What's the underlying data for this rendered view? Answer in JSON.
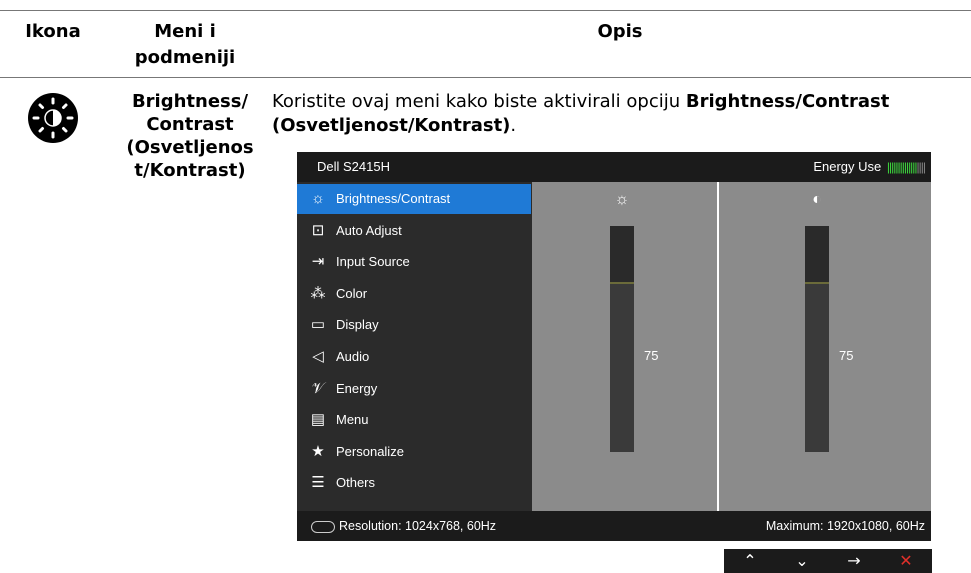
{
  "table": {
    "headers": {
      "icon": "Ikona",
      "menu_line1": "Meni i",
      "menu_line2": "podmeniji",
      "desc": "Opis"
    },
    "row": {
      "submenu_lines": [
        "Brightness/",
        "Contrast",
        "(Osvetljenos",
        "t/Kontrast)"
      ],
      "desc_prefix": "Koristite ovaj meni kako biste aktivirali opciju ",
      "desc_bold": "Brightness/Contrast (Osvetljenost/Kontrast)",
      "desc_suffix": "."
    }
  },
  "osd": {
    "model": "Dell S2415H",
    "energy_label": "Energy Use",
    "energy_on": "||||||||||||||",
    "energy_off": "||||",
    "menu_items": [
      {
        "label": "Brightness/Contrast",
        "icon": "brightness-icon",
        "glyph": "☼"
      },
      {
        "label": "Auto Adjust",
        "icon": "auto-adjust-icon",
        "glyph": "⊡"
      },
      {
        "label": "Input Source",
        "icon": "input-source-icon",
        "glyph": "⇥"
      },
      {
        "label": "Color",
        "icon": "color-icon",
        "glyph": "⁂"
      },
      {
        "label": "Display",
        "icon": "display-icon",
        "glyph": "▭"
      },
      {
        "label": "Audio",
        "icon": "audio-icon",
        "glyph": "◁"
      },
      {
        "label": "Energy",
        "icon": "energy-icon",
        "glyph": "𝒱"
      },
      {
        "label": "Menu",
        "icon": "menu-icon",
        "glyph": "▤"
      },
      {
        "label": "Personalize",
        "icon": "star-icon",
        "glyph": "★"
      },
      {
        "label": "Others",
        "icon": "others-icon",
        "glyph": "☰"
      }
    ],
    "brightness": 75,
    "contrast": 75,
    "brightness_label": "75",
    "contrast_label": "75",
    "resolution": "Resolution: 1024x768, 60Hz",
    "maximum": "Maximum: 1920x1080, 60Hz",
    "nav": [
      {
        "name": "up-arrow-icon",
        "glyph": "⌃",
        "color": "#ffffff"
      },
      {
        "name": "down-arrow-icon",
        "glyph": "⌄",
        "color": "#ffffff"
      },
      {
        "name": "right-arrow-icon",
        "glyph": "→",
        "color": "#ffffff"
      },
      {
        "name": "close-icon",
        "glyph": "✕",
        "color": "#e0302a"
      }
    ]
  }
}
